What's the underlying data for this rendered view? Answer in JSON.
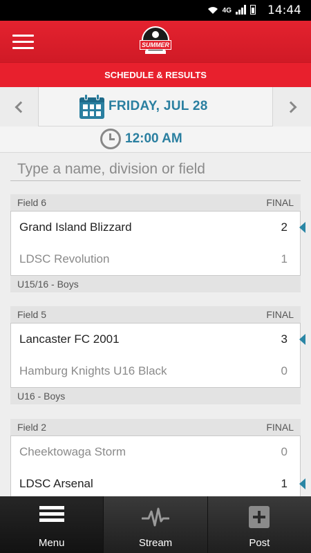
{
  "status": {
    "time": "14:44",
    "network": "4G"
  },
  "header": {
    "logo_text": "SUMMER",
    "title": "SCHEDULE & RESULTS"
  },
  "date": {
    "label": "FRIDAY, JUL 28"
  },
  "time": {
    "label": "12:00 AM"
  },
  "search": {
    "placeholder": "Type a name, division or field"
  },
  "games": [
    {
      "field": "Field 6",
      "status": "FINAL",
      "teams": [
        {
          "name": "Grand Island Blizzard",
          "score": "2",
          "winner": true
        },
        {
          "name": "LDSC Revolution",
          "score": "1",
          "winner": false
        }
      ],
      "division": "U15/16 - Boys"
    },
    {
      "field": "Field 5",
      "status": "FINAL",
      "teams": [
        {
          "name": "Lancaster FC 2001",
          "score": "3",
          "winner": true
        },
        {
          "name": "Hamburg Knights U16 Black",
          "score": "0",
          "winner": false
        }
      ],
      "division": "U16 - Boys"
    },
    {
      "field": "Field 2",
      "status": "FINAL",
      "teams": [
        {
          "name": "Cheektowaga Storm",
          "score": "0",
          "winner": false
        },
        {
          "name": "LDSC Arsenal",
          "score": "1",
          "winner": true
        }
      ],
      "division": ""
    }
  ],
  "tabs": [
    {
      "label": "Menu",
      "icon": "menu-icon"
    },
    {
      "label": "Stream",
      "icon": "pulse-icon"
    },
    {
      "label": "Post",
      "icon": "plus-icon"
    }
  ],
  "colors": {
    "brand_red": "#e4222f",
    "accent_blue": "#2a7fa0"
  }
}
